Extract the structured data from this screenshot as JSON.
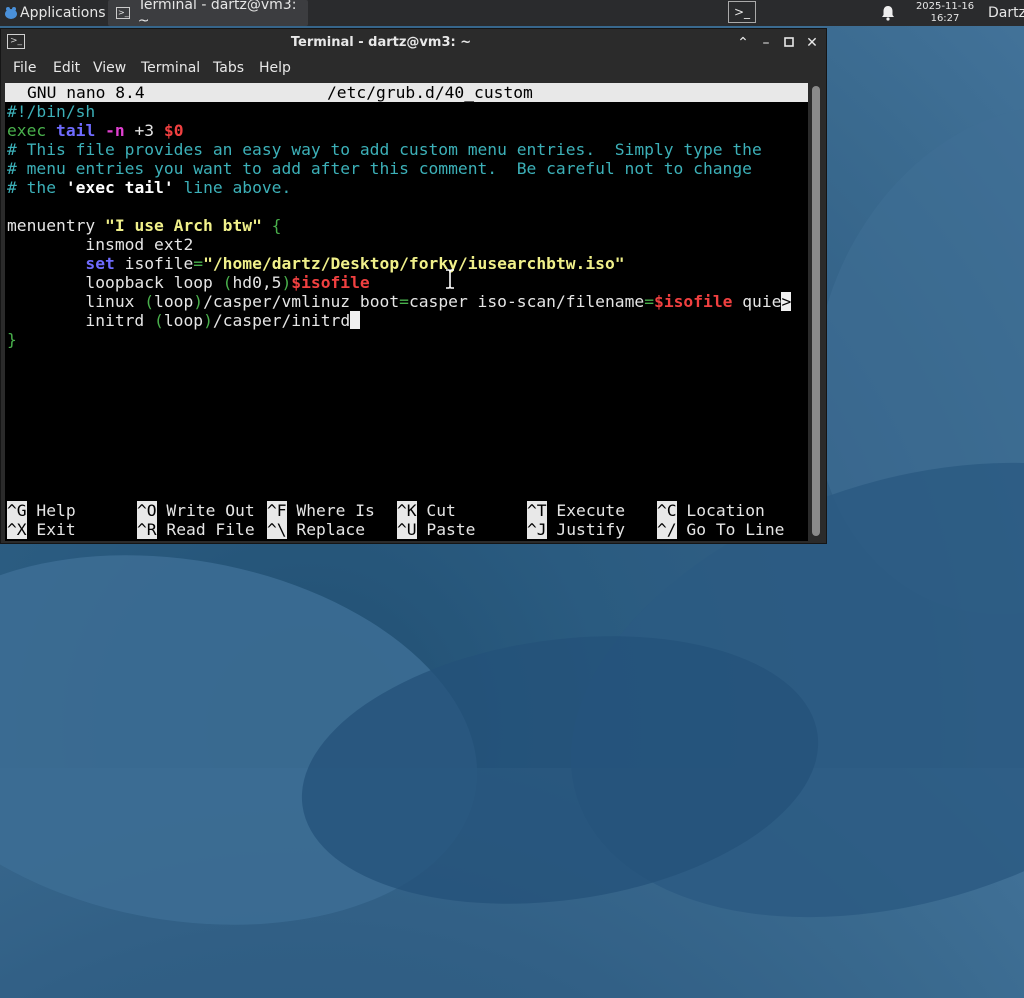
{
  "panel": {
    "applications_label": "Applications",
    "task_title": "Terminal - dartz@vm3: ~",
    "date": "2025-11-16",
    "time": "16:27",
    "user": "Dartz"
  },
  "window": {
    "title": "Terminal - dartz@vm3: ~",
    "menu": [
      "File",
      "Edit",
      "View",
      "Terminal",
      "Tabs",
      "Help"
    ]
  },
  "nano": {
    "version": "GNU nano 8.4",
    "filename": "/etc/grub.d/40_custom",
    "lines": {
      "l1": "#!/bin/sh",
      "l2_exec": "exec",
      "l2_tail": "tail",
      "l2_n": "-n",
      "l2_num": "+3",
      "l2_var": "$0",
      "l3": "# This file provides an easy way to add custom menu entries.  Simply type the",
      "l4": "# menu entries you want to add after this comment.  Be careful not to change",
      "l5_a": "# the ",
      "l5_b": "'exec tail'",
      "l5_c": " line above.",
      "l7_a": "menuentry ",
      "l7_b": "\"I use Arch btw\"",
      "l7_c": " {",
      "l8": "        insmod ext2",
      "l9_set": "set",
      "l9_a": " isofile",
      "l9_eq": "=",
      "l9_str": "\"/home/dartz/Desktop/forky/iusearchbtw.iso\"",
      "l10_a": "        loopback loop ",
      "l10_p1": "(",
      "l10_b": "hd0,5",
      "l10_p2": ")",
      "l10_var": "$isofile",
      "l11_a": "        linux ",
      "l11_p1": "(",
      "l11_b": "loop",
      "l11_p2": ")",
      "l11_c": "/casper/vmlinuz boot",
      "l11_eq1": "=",
      "l11_d": "casper iso-scan/filename",
      "l11_eq2": "=",
      "l11_var": "$isofile",
      "l11_e": " quie",
      "l11_more": ">",
      "l12_a": "        initrd ",
      "l12_p1": "(",
      "l12_b": "loop",
      "l12_p2": ")",
      "l12_c": "/casper/initrd",
      "l13": "}"
    },
    "shortcuts": [
      {
        "key": "^G",
        "label": "Help"
      },
      {
        "key": "^O",
        "label": "Write Out"
      },
      {
        "key": "^F",
        "label": "Where Is"
      },
      {
        "key": "^K",
        "label": "Cut"
      },
      {
        "key": "^T",
        "label": "Execute"
      },
      {
        "key": "^C",
        "label": "Location"
      },
      {
        "key": "^X",
        "label": "Exit"
      },
      {
        "key": "^R",
        "label": "Read File"
      },
      {
        "key": "^\\",
        "label": "Replace"
      },
      {
        "key": "^U",
        "label": "Paste"
      },
      {
        "key": "^J",
        "label": "Justify"
      },
      {
        "key": "^/",
        "label": "Go To Line"
      }
    ]
  },
  "icons": {
    "apps": "xfce-mouse-icon",
    "terminal": "terminal-icon",
    "bell": "bell-icon",
    "minimize": "minimize-icon",
    "maximize": "maximize-icon",
    "close": "close-icon",
    "up": "chevron-up-icon"
  }
}
